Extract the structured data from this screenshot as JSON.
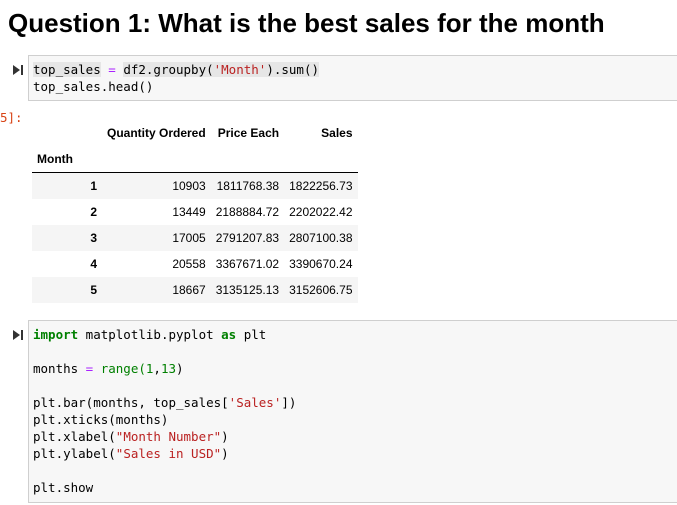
{
  "heading": "Question 1: What is the best sales for the month",
  "cell1": {
    "line1_var": "top_sales",
    "line1_eq": " = ",
    "line1_call": "df2.groupby(",
    "line1_arg": "'Month'",
    "line1_tail": ").sum()",
    "line2": "top_sales.head()"
  },
  "output_prompt": "5]:",
  "table": {
    "index_name": "Month",
    "columns": [
      "Quantity Ordered",
      "Price Each",
      "Sales"
    ],
    "rows": [
      {
        "index": "1",
        "values": [
          "10903",
          "1811768.38",
          "1822256.73"
        ]
      },
      {
        "index": "2",
        "values": [
          "13449",
          "2188884.72",
          "2202022.42"
        ]
      },
      {
        "index": "3",
        "values": [
          "17005",
          "2791207.83",
          "2807100.38"
        ]
      },
      {
        "index": "4",
        "values": [
          "20558",
          "3367671.02",
          "3390670.24"
        ]
      },
      {
        "index": "5",
        "values": [
          "18667",
          "3135125.13",
          "3152606.75"
        ]
      }
    ]
  },
  "cell2": {
    "import_kw": "import",
    "import_mod": " matplotlib.pyplot ",
    "as_kw": "as",
    "import_alias": " plt",
    "months_var": "months",
    "months_eq": " = ",
    "months_range": "range(",
    "range_start": "1",
    "range_comma": ",",
    "range_end": "13",
    "range_close": ")",
    "bar_head": "plt.bar(months, top_sales[",
    "bar_arg": "'Sales'",
    "bar_tail": "])",
    "xticks": "plt.xticks(months)",
    "xlabel_head": "plt.xlabel(",
    "xlabel_arg": "\"Month Number\"",
    "xlabel_tail": ")",
    "ylabel_head": "plt.ylabel(",
    "ylabel_arg": "\"Sales in USD\"",
    "ylabel_tail": ")",
    "show": "plt.show"
  },
  "icons": {
    "run": "run-cell-icon"
  }
}
